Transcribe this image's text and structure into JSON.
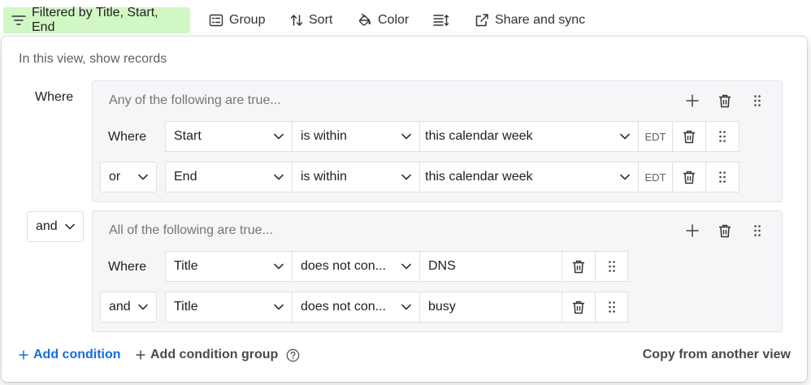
{
  "toolbar": {
    "filter_label": "Filtered by Title, Start, End",
    "group_label": "Group",
    "sort_label": "Sort",
    "color_label": "Color",
    "share_label": "Share and sync"
  },
  "popover": {
    "intro": "In this view, show records",
    "where_label": "Where",
    "group_conjunction": "and",
    "groups": [
      {
        "title": "Any of the following are true...",
        "conditions": [
          {
            "conjunction": "Where",
            "field": "Start",
            "operator": "is within",
            "value": "this calendar week",
            "timezone": "EDT"
          },
          {
            "conjunction": "or",
            "field": "End",
            "operator": "is within",
            "value": "this calendar week",
            "timezone": "EDT"
          }
        ]
      },
      {
        "title": "All of the following are true...",
        "conditions": [
          {
            "conjunction": "Where",
            "field": "Title",
            "operator": "does not con...",
            "value": "DNS"
          },
          {
            "conjunction": "and",
            "field": "Title",
            "operator": "does not con...",
            "value": "busy"
          }
        ]
      }
    ],
    "add_condition": "Add condition",
    "add_condition_group": "Add condition group",
    "copy_from_view": "Copy from another view"
  },
  "colors": {
    "filter_active_bg": "#d1f7c4",
    "link_blue": "#166ee1",
    "group_bg": "#f5f6f8"
  }
}
